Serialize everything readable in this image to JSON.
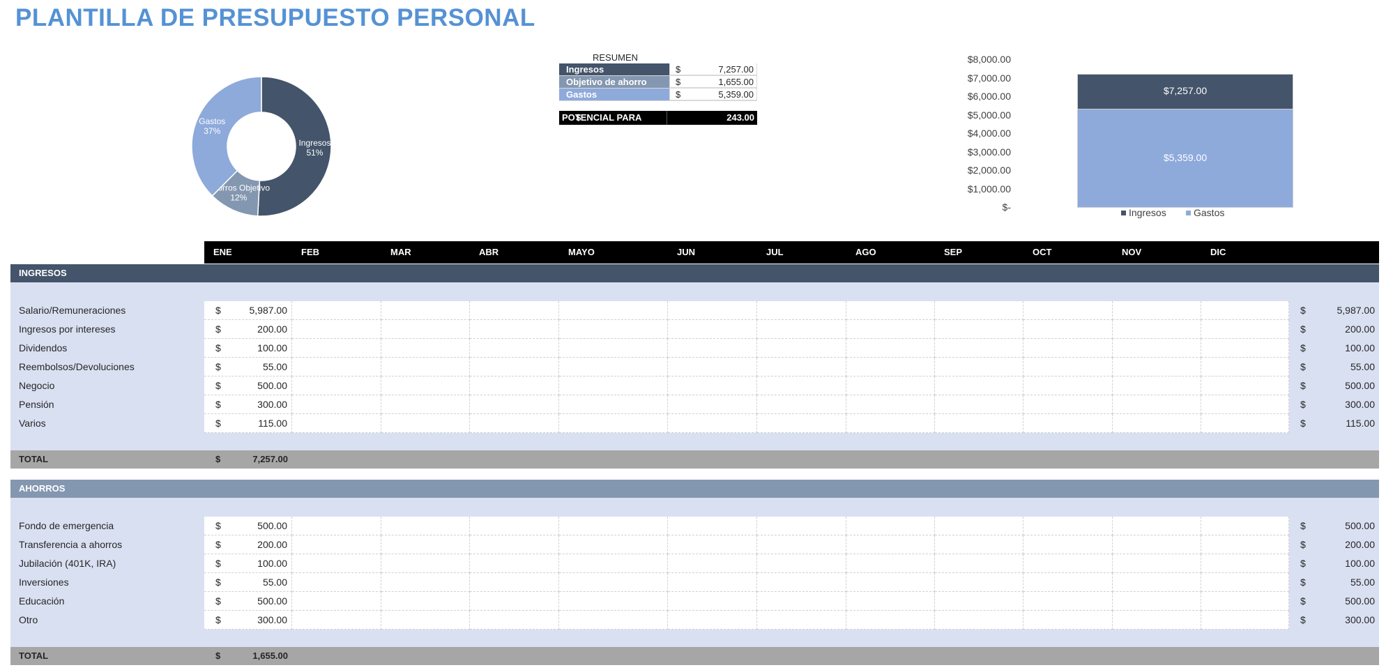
{
  "title": "PLANTILLA DE PRESUPUESTO PERSONAL",
  "colors": {
    "ingresos": "#44546a",
    "ahorros": "#8497b0",
    "gastos": "#8eaadb",
    "band": "#d9e0f2",
    "total": "#a6a6a6",
    "title": "#5592d4"
  },
  "summary": {
    "heading": "RESUMEN",
    "rows": [
      {
        "label": "Ingresos",
        "currency": "$",
        "value": "7,257.00"
      },
      {
        "label": "Objetivo de ahorro",
        "currency": "$",
        "value": "1,655.00"
      },
      {
        "label": "Gastos",
        "currency": "$",
        "value": "5,359.00"
      }
    ],
    "potential": {
      "label": "POTENCIAL PARA",
      "currency": "$",
      "value": "243.00"
    }
  },
  "chart_data": [
    {
      "type": "pie",
      "donut": true,
      "slices": [
        {
          "label": "Ingresos",
          "percent_label": "51%",
          "value": 7257
        },
        {
          "label": "Ahorros Objetivo",
          "percent_label": "12%",
          "value": 1655
        },
        {
          "label": "Gastos",
          "percent_label": "37%",
          "value": 5359
        }
      ]
    },
    {
      "type": "bar",
      "overlap": true,
      "categories": [
        ""
      ],
      "series": [
        {
          "name": "Ingresos",
          "values": [
            7257
          ],
          "label": "$7,257.00"
        },
        {
          "name": "Gastos",
          "values": [
            5359
          ],
          "label": "$5,359.00"
        }
      ],
      "ylim": [
        0,
        8000
      ],
      "yticks": [
        "$8,000.00",
        "$7,000.00",
        "$6,000.00",
        "$5,000.00",
        "$4,000.00",
        "$3,000.00",
        "$2,000.00",
        "$1,000.00",
        "$-"
      ],
      "legend": "bottom"
    }
  ],
  "months": [
    "ENE",
    "FEB",
    "MAR",
    "ABR",
    "MAYO",
    "JUN",
    "JUL",
    "AGO",
    "SEP",
    "OCT",
    "NOV",
    "DIC"
  ],
  "sections": [
    {
      "heading": "INGRESOS",
      "rows": [
        {
          "label": "Salario/Remuneraciones",
          "ene": "5,987.00",
          "total": "5,987.00"
        },
        {
          "label": "Ingresos por intereses",
          "ene": "200.00",
          "total": "200.00"
        },
        {
          "label": "Dividendos",
          "ene": "100.00",
          "total": "100.00"
        },
        {
          "label": "Reembolsos/Devoluciones",
          "ene": "55.00",
          "total": "55.00"
        },
        {
          "label": "Negocio",
          "ene": "500.00",
          "total": "500.00"
        },
        {
          "label": "Pensión",
          "ene": "300.00",
          "total": "300.00"
        },
        {
          "label": "Varios",
          "ene": "115.00",
          "total": "115.00"
        }
      ],
      "total_label": "TOTAL",
      "total_value": "7,257.00"
    },
    {
      "heading": "AHORROS",
      "rows": [
        {
          "label": "Fondo de emergencia",
          "ene": "500.00",
          "total": "500.00"
        },
        {
          "label": "Transferencia a ahorros",
          "ene": "200.00",
          "total": "200.00"
        },
        {
          "label": "Jubilación (401K, IRA)",
          "ene": "100.00",
          "total": "100.00"
        },
        {
          "label": "Inversiones",
          "ene": "55.00",
          "total": "55.00"
        },
        {
          "label": "Educación",
          "ene": "500.00",
          "total": "500.00"
        },
        {
          "label": "Otro",
          "ene": "300.00",
          "total": "300.00"
        }
      ],
      "total_label": "TOTAL",
      "total_value": "1,655.00"
    }
  ],
  "currency": "$"
}
